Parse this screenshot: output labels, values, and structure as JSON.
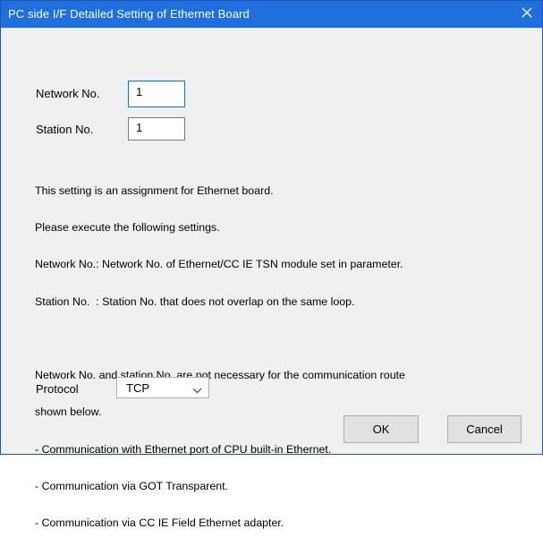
{
  "dialog": {
    "title": "PC side I/F Detailed Setting of Ethernet Board"
  },
  "fields": {
    "network_no_label": "Network No.",
    "network_no_value": "1",
    "station_no_label": "Station No.",
    "station_no_value": "1"
  },
  "info": {
    "lines": [
      "This setting is an assignment for Ethernet board.",
      "Please execute the following settings.",
      "Network No.: Network No. of Ethernet/CC IE TSN module set in parameter.",
      "Station No.  : Station No. that does not overlap on the same loop.",
      "",
      "Network No. and station No. are not necessary for the communication route",
      "shown below.",
      "- Communication with Ethernet port of CPU built-in Ethernet.",
      "- Communication via GOT Transparent.",
      "- Communication via CC IE Field Ethernet adapter."
    ]
  },
  "protocol": {
    "label": "Protocol",
    "selected": "TCP"
  },
  "buttons": {
    "ok": "OK",
    "cancel": "Cancel"
  },
  "colors": {
    "title_bar": "#1f6fdc",
    "dialog_bg": "#f0f0f0",
    "focus_border": "#0078d7",
    "button_bg": "#e1e1e1"
  },
  "icons": {
    "close": "close-icon",
    "dropdown": "chevron-down-icon"
  }
}
